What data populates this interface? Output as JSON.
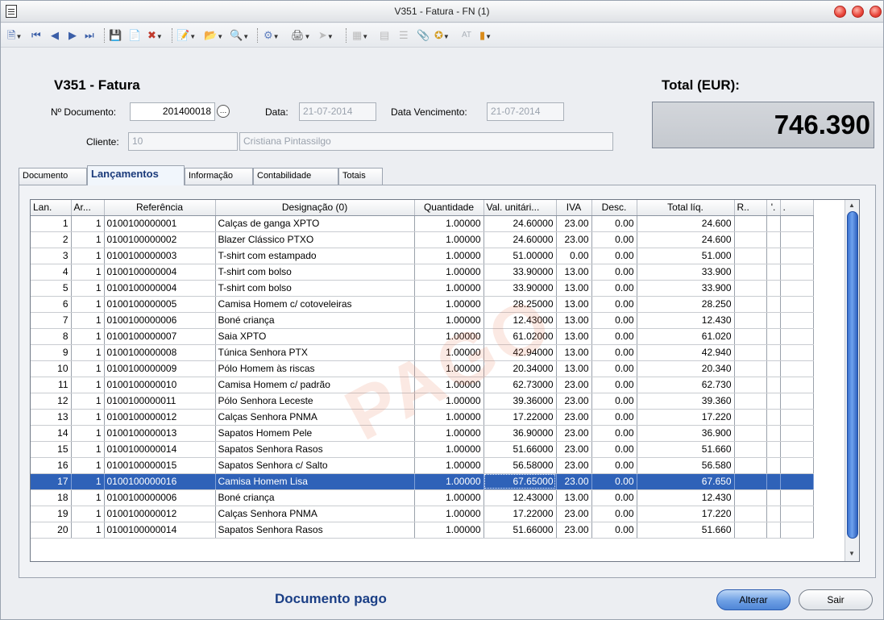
{
  "window": {
    "title": "V351 - Fatura - FN (1)"
  },
  "header": {
    "doc_title": "V351 - Fatura",
    "doc_number_label": "Nº Documento:",
    "doc_number": "201400018",
    "date_label": "Data:",
    "date": "21-07-2014",
    "due_label": "Data Vencimento:",
    "due_date": "21-07-2014",
    "client_label": "Cliente:",
    "client_code": "10",
    "client_name": "Cristiana Pintassilgo",
    "total_label": "Total (EUR):",
    "total_value": "746.390"
  },
  "toolbar": {
    "at_label": "AT"
  },
  "tabs": [
    "Documento",
    "Lançamentos",
    "Informação",
    "Contabilidade",
    "Totais"
  ],
  "grid": {
    "columns": [
      "Lan.",
      "Ar...",
      "Referência",
      "Designação (0)",
      "Quantidade",
      "Val. unitári...",
      "IVA",
      "Desc.",
      "Total líq.",
      "R..",
      "'.",
      "."
    ],
    "rows": [
      [
        "1",
        "1",
        "0100100000001",
        "Calças de ganga XPTO",
        "1.00000",
        "24.60000",
        "23.00",
        "0.00",
        "24.600"
      ],
      [
        "2",
        "1",
        "0100100000002",
        "Blazer Clássico PTXO",
        "1.00000",
        "24.60000",
        "23.00",
        "0.00",
        "24.600"
      ],
      [
        "3",
        "1",
        "0100100000003",
        "T-shirt com estampado",
        "1.00000",
        "51.00000",
        "0.00",
        "0.00",
        "51.000"
      ],
      [
        "4",
        "1",
        "0100100000004",
        "T-shirt com bolso",
        "1.00000",
        "33.90000",
        "13.00",
        "0.00",
        "33.900"
      ],
      [
        "5",
        "1",
        "0100100000004",
        "T-shirt com bolso",
        "1.00000",
        "33.90000",
        "13.00",
        "0.00",
        "33.900"
      ],
      [
        "6",
        "1",
        "0100100000005",
        "Camisa Homem c/ cotoveleiras",
        "1.00000",
        "28.25000",
        "13.00",
        "0.00",
        "28.250"
      ],
      [
        "7",
        "1",
        "0100100000006",
        "Boné criança",
        "1.00000",
        "12.43000",
        "13.00",
        "0.00",
        "12.430"
      ],
      [
        "8",
        "1",
        "0100100000007",
        "Saia XPTO",
        "1.00000",
        "61.02000",
        "13.00",
        "0.00",
        "61.020"
      ],
      [
        "9",
        "1",
        "0100100000008",
        "Túnica Senhora PTX",
        "1.00000",
        "42.94000",
        "13.00",
        "0.00",
        "42.940"
      ],
      [
        "10",
        "1",
        "0100100000009",
        "Pólo Homem às riscas",
        "1.00000",
        "20.34000",
        "13.00",
        "0.00",
        "20.340"
      ],
      [
        "11",
        "1",
        "0100100000010",
        "Camisa Homem c/ padrão",
        "1.00000",
        "62.73000",
        "23.00",
        "0.00",
        "62.730"
      ],
      [
        "12",
        "1",
        "0100100000011",
        "Pólo Senhora Leceste",
        "1.00000",
        "39.36000",
        "23.00",
        "0.00",
        "39.360"
      ],
      [
        "13",
        "1",
        "0100100000012",
        "Calças Senhora PNMA",
        "1.00000",
        "17.22000",
        "23.00",
        "0.00",
        "17.220"
      ],
      [
        "14",
        "1",
        "0100100000013",
        "Sapatos Homem Pele",
        "1.00000",
        "36.90000",
        "23.00",
        "0.00",
        "36.900"
      ],
      [
        "15",
        "1",
        "0100100000014",
        "Sapatos Senhora Rasos",
        "1.00000",
        "51.66000",
        "23.00",
        "0.00",
        "51.660"
      ],
      [
        "16",
        "1",
        "0100100000015",
        "Sapatos Senhora c/ Salto",
        "1.00000",
        "56.58000",
        "23.00",
        "0.00",
        "56.580"
      ],
      [
        "17",
        "1",
        "0100100000016",
        "Camisa Homem Lisa",
        "1.00000",
        "67.65000",
        "23.00",
        "0.00",
        "67.650"
      ],
      [
        "18",
        "1",
        "0100100000006",
        "Boné criança",
        "1.00000",
        "12.43000",
        "13.00",
        "0.00",
        "12.430"
      ],
      [
        "19",
        "1",
        "0100100000012",
        "Calças Senhora PNMA",
        "1.00000",
        "17.22000",
        "23.00",
        "0.00",
        "17.220"
      ],
      [
        "20",
        "1",
        "0100100000014",
        "Sapatos Senhora Rasos",
        "1.00000",
        "51.66000",
        "23.00",
        "0.00",
        "51.660"
      ]
    ],
    "selected_row": 17,
    "watermark": "PAGO"
  },
  "footer": {
    "status": "Documento pago",
    "alter_label": "Alterar",
    "exit_label": "Sair"
  },
  "colors": {
    "selection": "#2f62b8",
    "status_text": "#1b3f86",
    "primary_button": "#6d9fe4"
  }
}
